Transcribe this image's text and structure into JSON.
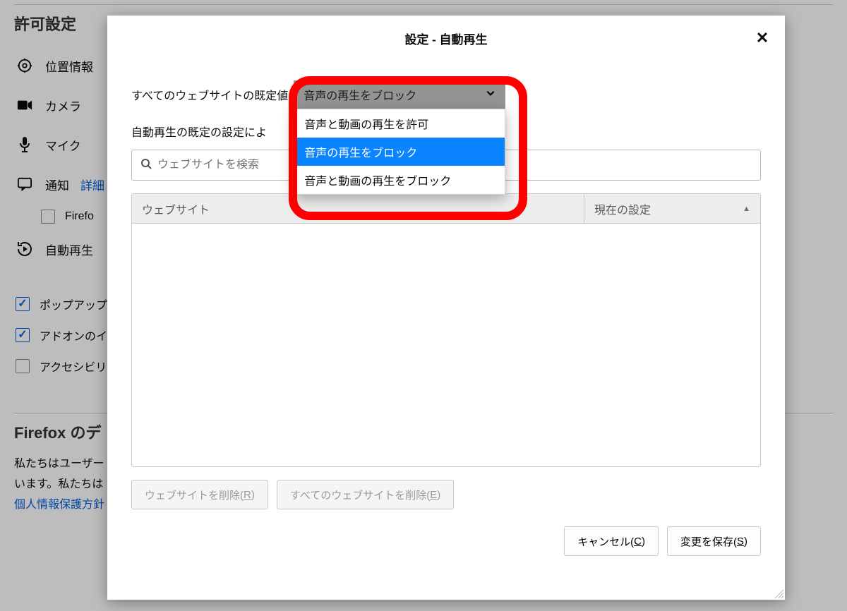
{
  "bg": {
    "section_title": "許可設定",
    "items": {
      "location": "位置情報",
      "camera": "カメラ",
      "mic": "マイク",
      "notify": "通知",
      "notify_link": "詳細",
      "notify_sub_partial": "Firefo",
      "autoplay": "自動再生",
      "popup_partial": "ポップアップ",
      "addon_partial": "アドオンのイ",
      "accessibility_partial": "アクセシビリ"
    },
    "section2_title": "Firefox のデ",
    "body_text_1": "私たちはユーザー",
    "body_text_2": "います。私たちは",
    "privacy_link": "個人情報保護方針"
  },
  "modal": {
    "title": "設定 - 自動再生",
    "default_label": "すべてのウェブサイトの既定値",
    "default_select": {
      "value": "音声の再生をブロック",
      "options": [
        "音声と動画の再生を許可",
        "音声の再生をブロック",
        "音声と動画の再生をブロック"
      ],
      "selected_index": 1
    },
    "desc_partial": "自動再生の既定の設定によ",
    "search_placeholder": "ウェブサイトを検索",
    "table": {
      "col_site": "ウェブサイト",
      "col_status": "現在の設定"
    },
    "buttons": {
      "remove": {
        "prefix": "ウェブサイトを削除(",
        "access": "R",
        "suffix": ")"
      },
      "remove_all": {
        "prefix": "すべてのウェブサイトを削除(",
        "access": "E",
        "suffix": ")"
      },
      "cancel": {
        "prefix": "キャンセル(",
        "access": "C",
        "suffix": ")"
      },
      "save": {
        "prefix": "変更を保存(",
        "access": "S",
        "suffix": ")"
      }
    }
  }
}
